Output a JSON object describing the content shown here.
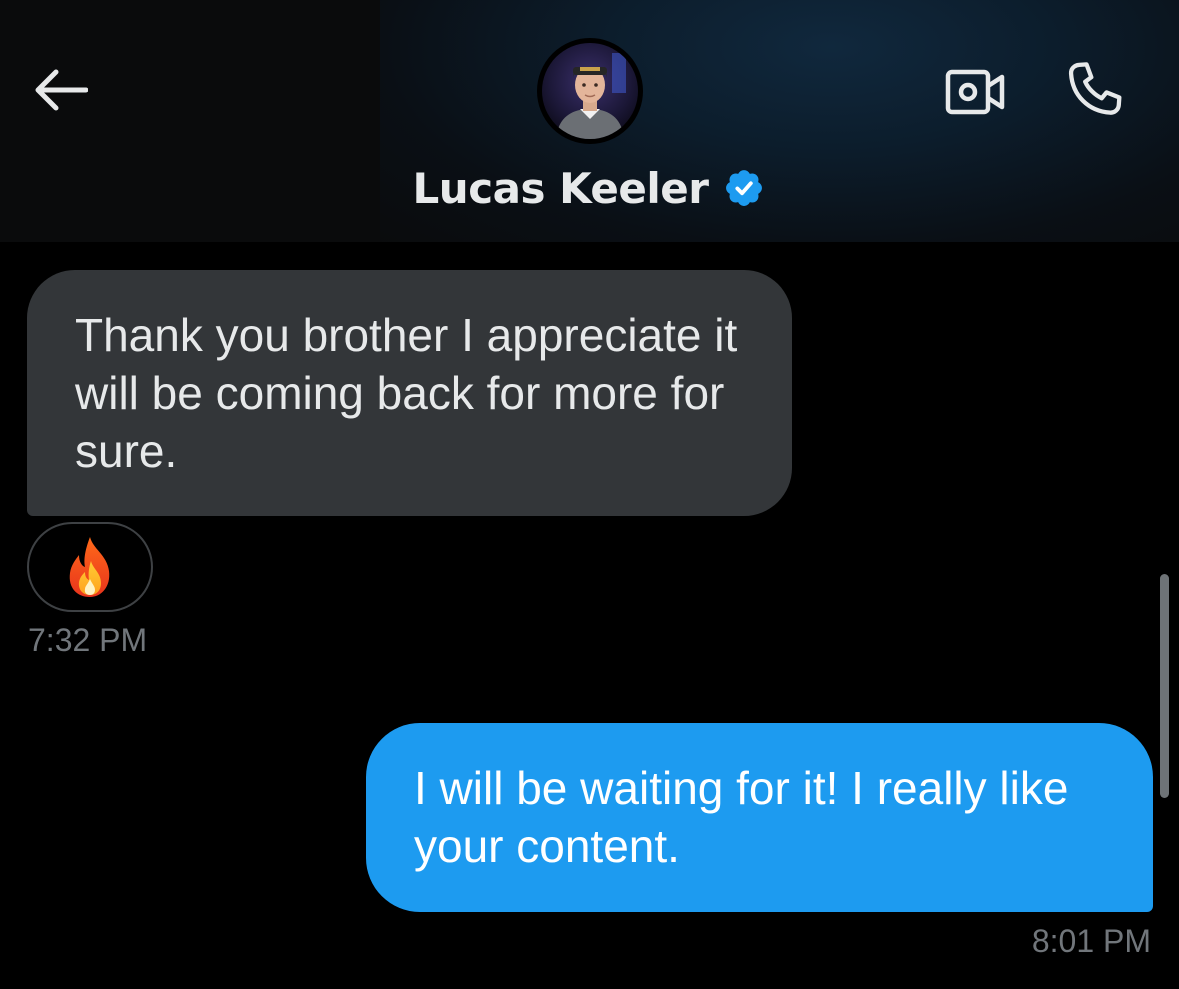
{
  "header": {
    "contact_name": "Lucas Keeler",
    "verified": true,
    "back_icon": "arrow-left-icon",
    "video_icon": "video-camera-icon",
    "call_icon": "phone-icon",
    "verified_icon": "verified-badge-icon",
    "avatar": "contact-avatar-photo"
  },
  "messages": [
    {
      "direction": "incoming",
      "text": "Thank you brother I appreciate it will be coming back for more for sure.",
      "reaction": "🔥",
      "time": "7:32 PM"
    },
    {
      "direction": "outgoing",
      "text": "I will be waiting for it! I really like your content.",
      "time": "8:01 PM"
    }
  ],
  "colors": {
    "background": "#000000",
    "incoming_bubble": "#333639",
    "outgoing_bubble": "#1d9bf0",
    "timestamp": "#71767b",
    "verified_badge": "#1d9bf0",
    "text_primary": "#e7e9ea"
  }
}
